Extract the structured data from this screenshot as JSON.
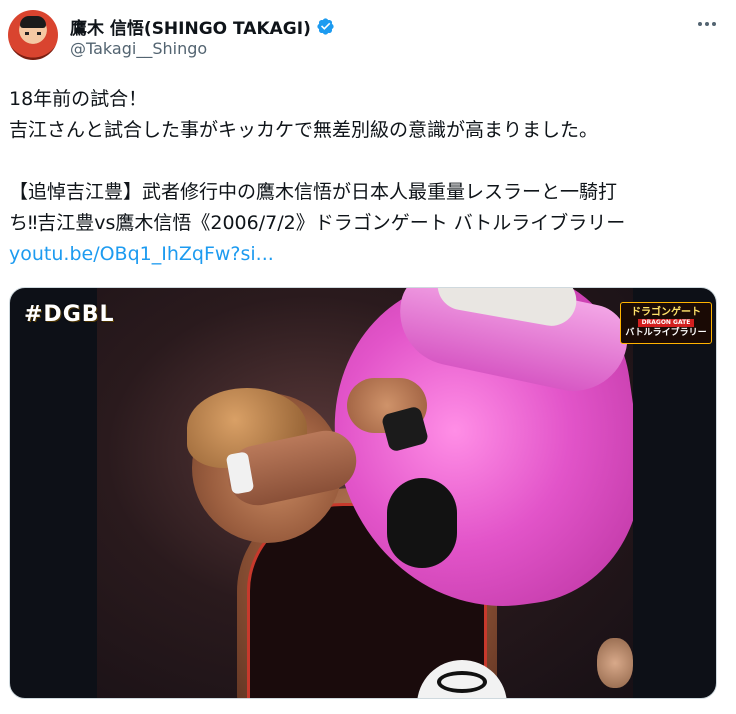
{
  "author": {
    "display_name": "鷹木 信悟(SHINGO TAKAGI)",
    "handle": "@Takagi__Shingo",
    "avatar_icon": "avatar-illustration",
    "verified_icon": "verified-badge-icon",
    "verified_color": "#1d9bf0"
  },
  "more_icon": "more-options-icon",
  "post": {
    "lines": [
      "18年前の試合！",
      "吉江さんと試合した事がキッカケで無差別級の意識が高まりました。"
    ],
    "quote_line1": "【追悼吉江豊】武者修行中の鷹木信悟が日本人最重量レスラーと一騎打",
    "quote_line2": "ち‼吉江豊vs鷹木信悟《2006/7/2》ドラゴンゲート バトルライブラリー",
    "link_text": "youtu.be/OBq1_IhZqFw?si..."
  },
  "media": {
    "overlay_logo": "#DGBL",
    "badge_top": "ドラゴンゲート",
    "badge_mid": "DRAGON GATE",
    "badge_bottom": "バトルライブラリー"
  },
  "colors": {
    "link": "#1d9bf0",
    "text": "#0f1419",
    "secondary": "#536471"
  }
}
